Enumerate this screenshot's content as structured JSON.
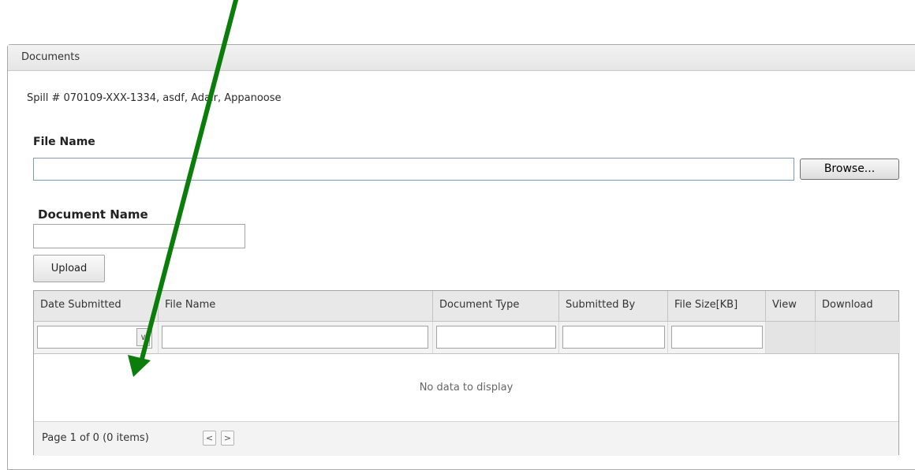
{
  "panel": {
    "title": "Documents",
    "spill_info": "Spill # 070109-XXX-1334, asdf, Adair, Appanoose"
  },
  "form": {
    "file_name_label": "File Name",
    "file_name_value": "",
    "browse_label": "Browse...",
    "document_name_label": "Document Name",
    "document_name_value": "",
    "upload_label": "Upload"
  },
  "grid": {
    "columns": [
      "Date Submitted",
      "File Name",
      "Document Type",
      "Submitted By",
      "File Size[KB]",
      "View",
      "Download"
    ],
    "dropdown_icon": "chevron-down-icon",
    "empty_text": "No data to display",
    "pager_text": "Page 1 of 0 (0 items)",
    "prev_icon": "chevron-left-icon",
    "next_icon": "chevron-right-icon"
  },
  "annotation": {
    "arrow_color": "#0a7d0a"
  }
}
